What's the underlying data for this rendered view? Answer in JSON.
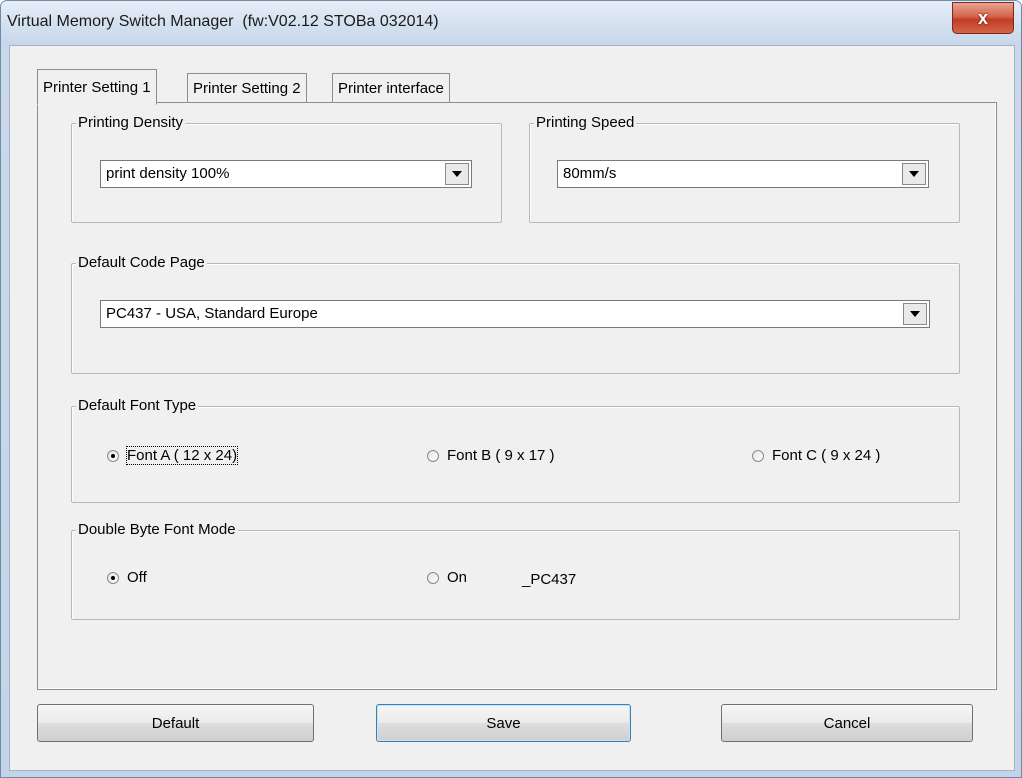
{
  "window": {
    "title": "Virtual Memory Switch Manager  (fw:V02.12 STOBa 032014)",
    "close_label": "x"
  },
  "tabs": [
    {
      "label": "Printer Setting 1",
      "active": true
    },
    {
      "label": "Printer Setting 2",
      "active": false
    },
    {
      "label": "Printer interface",
      "active": false
    }
  ],
  "printing_density": {
    "legend": "Printing Density",
    "selected": "print density 100%"
  },
  "printing_speed": {
    "legend": "Printing Speed",
    "selected": "80mm/s"
  },
  "code_page": {
    "legend": "Default Code Page",
    "selected": "PC437 - USA, Standard Europe"
  },
  "font_type": {
    "legend": "Default Font Type",
    "options": [
      {
        "label": "Font A ( 12 x 24)",
        "checked": true
      },
      {
        "label": "Font B ( 9 x 17 )",
        "checked": false
      },
      {
        "label": "Font C ( 9 x 24 )",
        "checked": false
      }
    ]
  },
  "double_byte": {
    "legend": "Double Byte Font Mode",
    "options": [
      {
        "label": "Off",
        "checked": true
      },
      {
        "label": "On",
        "checked": false
      }
    ],
    "info_text": "_PC437"
  },
  "buttons": {
    "default_label": "Default",
    "save_label": "Save",
    "cancel_label": "Cancel"
  },
  "colors": {
    "close_button": "#c23d22",
    "dialog_face": "#f0f0f0",
    "title_gradient": "#d3e0ef"
  }
}
